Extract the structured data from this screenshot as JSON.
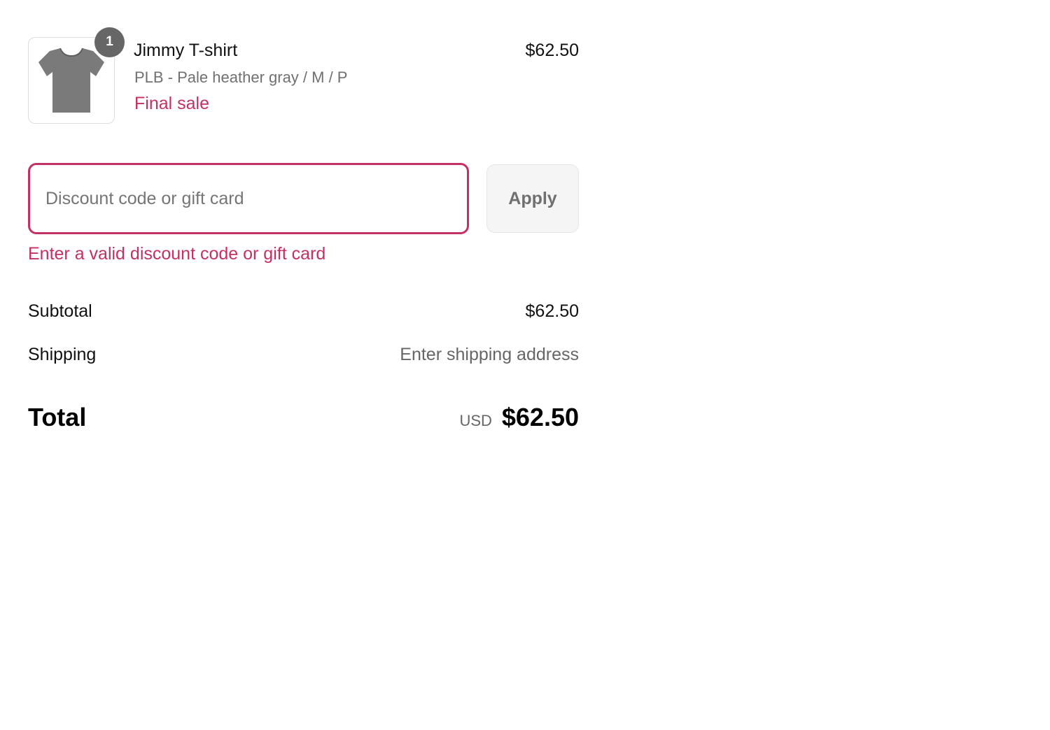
{
  "order_summary": {
    "line_item": {
      "quantity": "1",
      "name": "Jimmy T-shirt",
      "variant": "PLB - Pale heather gray / M / P",
      "tag": "Final sale",
      "price": "$62.50",
      "thumbnail_icon": "t-shirt-icon",
      "thumbnail_color": "#7a7a7a"
    },
    "discount": {
      "value": "",
      "placeholder": "Discount code or gift card",
      "apply_label": "Apply",
      "error": "Enter a valid discount code or gift card"
    },
    "costs": {
      "subtotal_label": "Subtotal",
      "subtotal_value": "$62.50",
      "shipping_label": "Shipping",
      "shipping_value": "Enter shipping address",
      "total_label": "Total",
      "total_currency": "USD",
      "total_value": "$62.50"
    }
  },
  "colors": {
    "error_accent": "#c4305f",
    "badge": "#666666"
  }
}
